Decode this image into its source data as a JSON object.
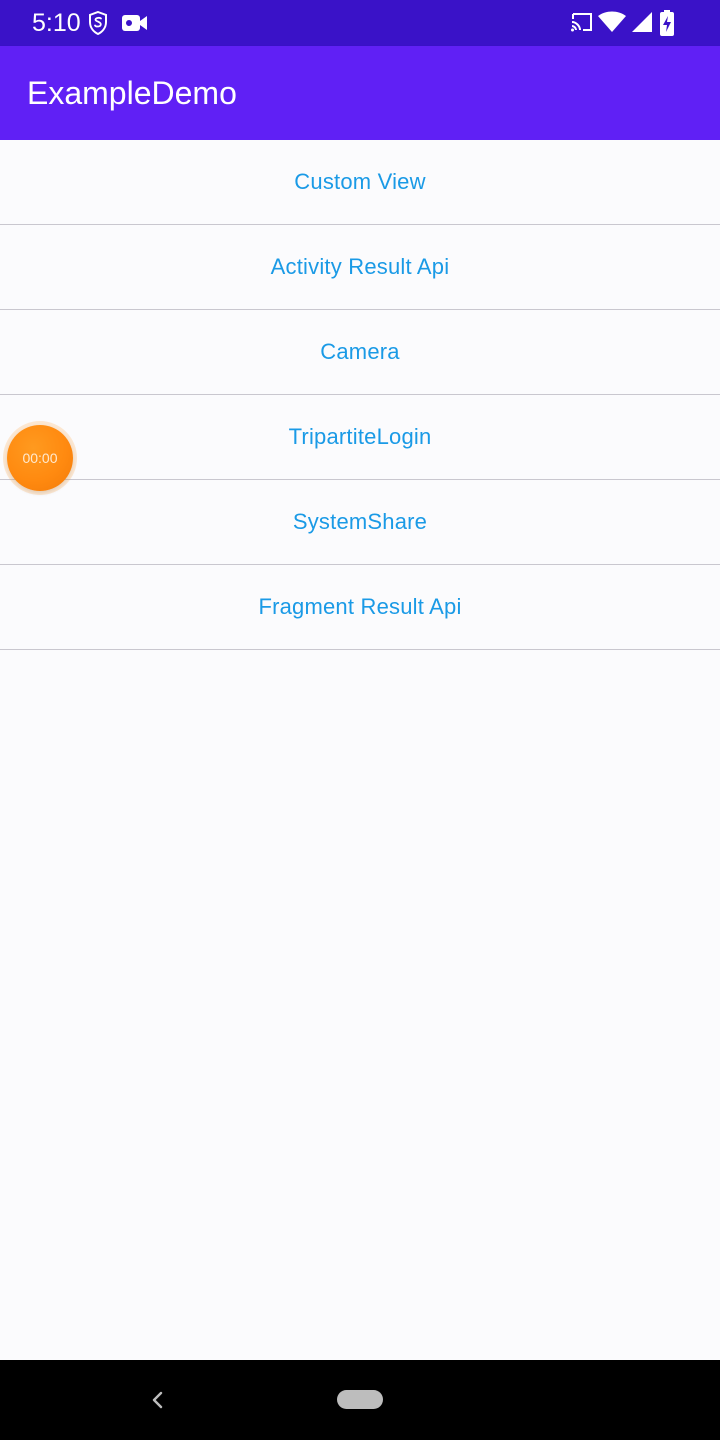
{
  "status_bar": {
    "time": "5:10",
    "left_icons": [
      "s-shield-icon",
      "video-camera-icon"
    ],
    "right_icons": [
      "cast-icon",
      "wifi-icon",
      "signal-icon",
      "battery-charging-icon"
    ],
    "color": "#3a12c8"
  },
  "app_bar": {
    "title": "ExampleDemo",
    "color": "#6020f5"
  },
  "menu": {
    "items": [
      {
        "label": "Custom View"
      },
      {
        "label": "Activity Result Api"
      },
      {
        "label": "Camera"
      },
      {
        "label": "TripartiteLogin"
      },
      {
        "label": "SystemShare"
      },
      {
        "label": "Fragment Result Api"
      }
    ],
    "text_color": "#1a9ae6"
  },
  "recorder_bubble": {
    "time": "00:00",
    "color": "#ff8a10"
  },
  "nav_bar": {
    "icons": [
      "back-icon",
      "home-pill-icon"
    ]
  }
}
